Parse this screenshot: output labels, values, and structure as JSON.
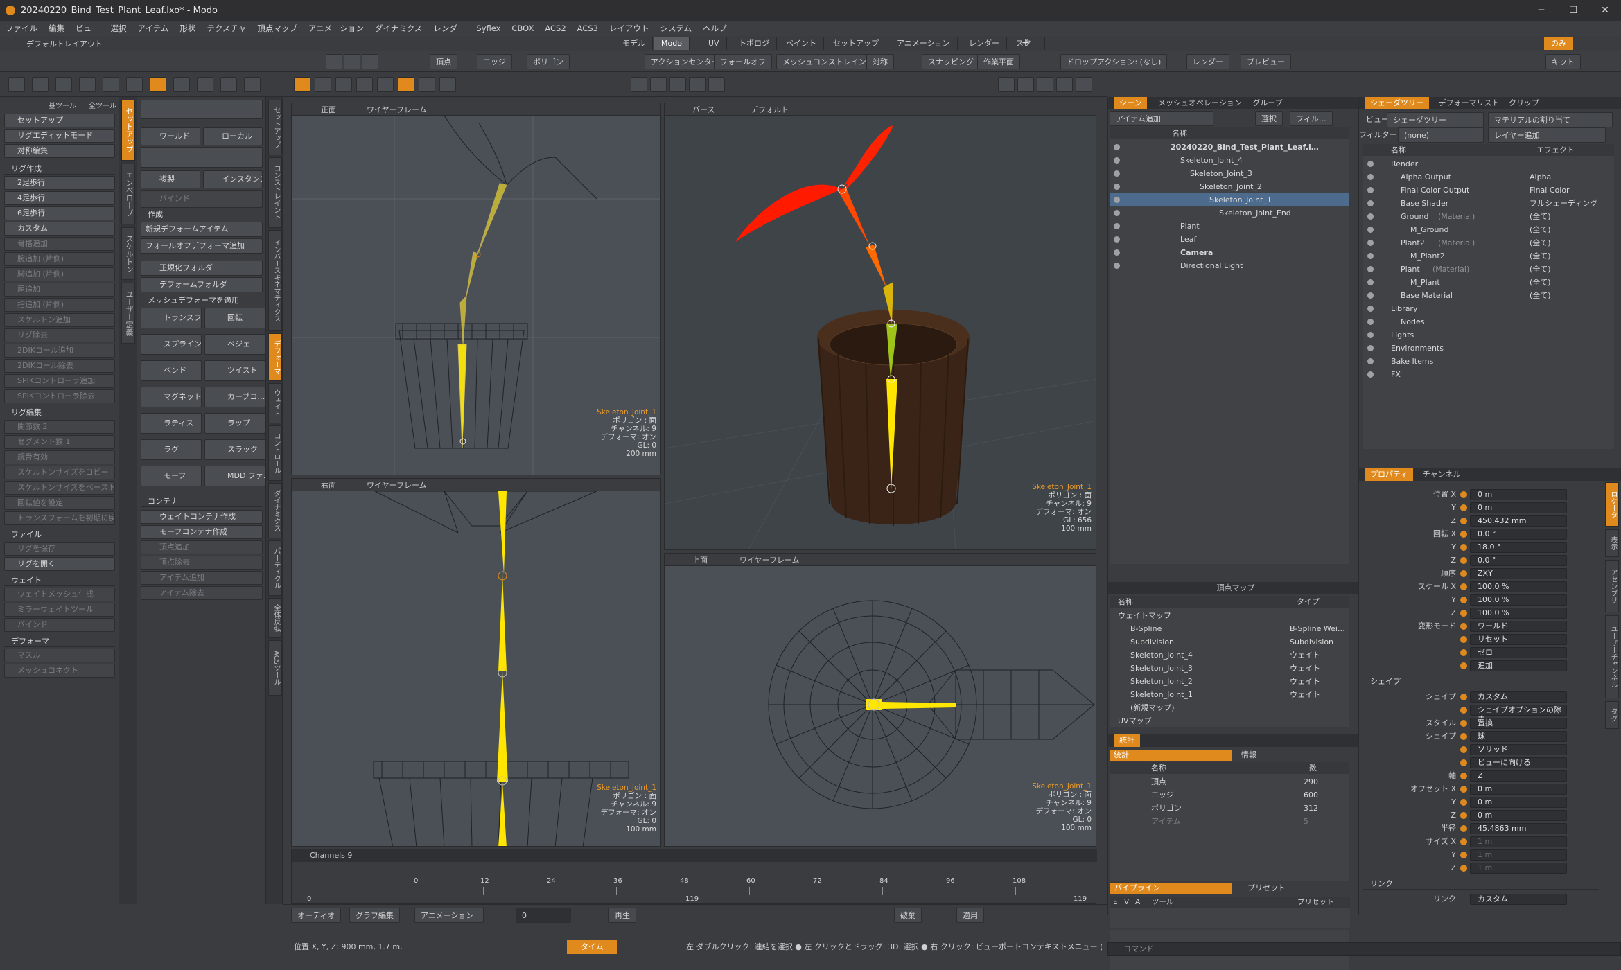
{
  "window": {
    "title": "20240220_Bind_Test_Plant_Leaf.lxo* - Modo",
    "min": "─",
    "max": "☐",
    "close": "✕"
  },
  "menu": [
    "ファイル",
    "編集",
    "ビュー",
    "選択",
    "アイテム",
    "形状",
    "テクスチャ",
    "頂点マップ",
    "アニメーション",
    "ダイナミクス",
    "レンダー",
    "Syflex",
    "CBOX",
    "ACS2",
    "ACS3",
    "レイアウト",
    "システム",
    "ヘルプ"
  ],
  "layout": {
    "name": "デフォルトレイアウト",
    "tabs": [
      "モデル",
      "Modo",
      "UV",
      "トポロジ",
      "ペイント",
      "セットアップ",
      "アニメーション",
      "レンダー",
      "スクリプト"
    ],
    "active": "Modo",
    "plus": "+",
    "user": "のみ"
  },
  "toolbar": {
    "items": [
      "頂点",
      "エッジ",
      "ポリゴン",
      "アクションセンター",
      "フォールオフ",
      "メッシュコンストレイント",
      "対称",
      "スナッピング",
      "作業平面",
      "ドロップアクション: (なし)",
      "レンダー",
      "プレビュー",
      "キット"
    ]
  },
  "left_panel": {
    "top_tabs": [
      "基ツール",
      "全ツール"
    ],
    "buttons": [
      {
        "label": "セットアップ",
        "dim": false
      },
      {
        "label": "リグエディットモード",
        "dim": false
      },
      {
        "label": "対称編集",
        "dim": false
      }
    ],
    "sections": [
      {
        "title": "リグ作成",
        "items": [
          {
            "label": "2足歩行",
            "dim": false
          },
          {
            "label": "4足歩行",
            "dim": false
          },
          {
            "label": "6足歩行",
            "dim": false
          },
          {
            "label": "カスタム",
            "dim": false
          },
          {
            "label": "骨格追加",
            "dim": true
          },
          {
            "label": "腕追加 (片側)",
            "dim": true
          },
          {
            "label": "脚追加 (片側)",
            "dim": true
          },
          {
            "label": "尾追加",
            "dim": true
          },
          {
            "label": "指追加 (片側)",
            "dim": true
          },
          {
            "label": "スケルトン追加",
            "dim": true
          },
          {
            "label": "リグ除去",
            "dim": true
          },
          {
            "label": "2DIKコール追加",
            "dim": true
          },
          {
            "label": "2DIKコール除去",
            "dim": true
          },
          {
            "label": "SPIKコントローラ追加",
            "dim": true
          },
          {
            "label": "SPIKコントローラ除去",
            "dim": true
          }
        ]
      },
      {
        "title": "リグ編集",
        "items": [
          {
            "label": "関節数  2",
            "dim": true
          },
          {
            "label": "セグメント数  1",
            "dim": true
          },
          {
            "label": "鏡骨有効",
            "dim": true
          },
          {
            "label": "スケルトンサイズをコピー",
            "dim": true
          },
          {
            "label": "スケルトンサイズをペースト",
            "dim": true
          },
          {
            "label": "回転値を設定",
            "dim": true
          },
          {
            "label": "トランスフォームを初期に戻す",
            "dim": true
          }
        ]
      },
      {
        "title": "ファイル",
        "items": [
          {
            "label": "リグを保存",
            "dim": true
          },
          {
            "label": "リグを開く",
            "dim": false
          }
        ]
      },
      {
        "title": "ウェイト",
        "items": [
          {
            "label": "ウェイトメッシュ生成",
            "dim": true
          },
          {
            "label": "ミラーウェイトツール",
            "dim": true
          },
          {
            "label": "バインド",
            "dim": true
          }
        ]
      },
      {
        "title": "デフォーマ",
        "items": [
          {
            "label": "マスル",
            "dim": true
          },
          {
            "label": "メッシュコネクト",
            "dim": true
          }
        ]
      }
    ]
  },
  "side_tabs_1": [
    "セットアップ",
    "エンベロープ",
    "スケルトン",
    "ユーザー定義"
  ],
  "mid_panel": {
    "row1": [
      "ワールド",
      "ローカル"
    ],
    "row2": [
      "複製",
      "インスタンス"
    ],
    "bind": "バインド",
    "create_title": "作成",
    "new_deform": "新規デフォームアイテム",
    "falloff_deform": "フォールオフデフォーマ追加",
    "norm_folder": "正規化フォルダ",
    "deform_folder": "デフォームフォルダ",
    "mesh_deform": "メッシュデフォーマを適用",
    "tools": [
      [
        "トランスフ…",
        "回転"
      ],
      [
        "スプライン",
        "ベジェ"
      ],
      [
        "ベンド",
        "ツイスト"
      ],
      [
        "マグネット",
        "カーブコ…"
      ],
      [
        "ラティス",
        "ラップ"
      ],
      [
        "ラグ",
        "スラック"
      ],
      [
        "モーフ",
        "MDD ファ…"
      ]
    ],
    "container_title": "コンテナ",
    "containers": [
      {
        "label": "ウェイトコンテナ作成",
        "dim": false
      },
      {
        "label": "モーフコンテナ作成",
        "dim": false
      },
      {
        "label": "頂点追加",
        "dim": true
      },
      {
        "label": "頂点除去",
        "dim": true
      },
      {
        "label": "アイテム追加",
        "dim": true
      },
      {
        "label": "アイテム除去",
        "dim": true
      }
    ]
  },
  "side_tabs_2": [
    "セットアップ",
    "コンストレイント",
    "インバースキネマティクス",
    "デフォーマ",
    "ウェイト",
    "コントロール",
    "ダイナミクス",
    "パーティクル",
    "全体反転",
    "ACSツール"
  ],
  "viewports": [
    {
      "name": "正面",
      "mode": "ワイヤーフレーム",
      "info": {
        "item": "Skeleton_Joint_1",
        "poly": "ポリゴン : 面",
        "ch": "チャンネル: 9",
        "def": "デフォーマ: オン",
        "gl": "GL: 0",
        "scale": "200 mm"
      }
    },
    {
      "name": "パース",
      "mode": "デフォルト",
      "info": {
        "item": "Skeleton_Joint_1",
        "poly": "ポリゴン : 面",
        "ch": "チャンネル: 9",
        "def": "デフォーマ: オン",
        "gl": "GL: 656",
        "scale": "100 mm"
      }
    },
    {
      "name": "右面",
      "mode": "ワイヤーフレーム",
      "info": {
        "item": "Skeleton_Joint_1",
        "poly": "ポリゴン : 面",
        "ch": "チャンネル: 9",
        "def": "デフォーマ: オン",
        "gl": "GL: 0",
        "scale": "100 mm"
      }
    },
    {
      "name": "上面",
      "mode": "ワイヤーフレーム",
      "info": {
        "item": "Skeleton_Joint_1",
        "poly": "ポリゴン : 面",
        "ch": "チャンネル: 9",
        "def": "デフォーマ: オン",
        "gl": "GL: 0",
        "scale": "100 mm"
      }
    }
  ],
  "scene": {
    "tabs": [
      "シーン",
      "メッシュオペレーション",
      "グループ"
    ],
    "add_item": "アイテム追加",
    "select": "選択",
    "filter": "フィル…",
    "col_name": "名称",
    "rows": [
      {
        "label": "20240220_Bind_Test_Plant_Leaf.l…",
        "indent": 0,
        "sel": false,
        "bold": true
      },
      {
        "label": "Skeleton_Joint_4",
        "indent": 1,
        "sel": false,
        "bold": false
      },
      {
        "label": "Skeleton_Joint_3",
        "indent": 2,
        "sel": false,
        "bold": false
      },
      {
        "label": "Skeleton_Joint_2",
        "indent": 3,
        "sel": false,
        "bold": false
      },
      {
        "label": "Skeleton_Joint_1",
        "indent": 4,
        "sel": true,
        "bold": false
      },
      {
        "label": "Skeleton_Joint_End",
        "indent": 5,
        "sel": false,
        "bold": false
      },
      {
        "label": "Plant",
        "indent": 1,
        "sel": false,
        "bold": false
      },
      {
        "label": "Leaf",
        "indent": 1,
        "sel": false,
        "bold": false
      },
      {
        "label": "Camera",
        "indent": 1,
        "sel": false,
        "bold": true
      },
      {
        "label": "Directional Light",
        "indent": 1,
        "sel": false,
        "bold": false
      }
    ]
  },
  "vertex_map": {
    "title": "頂点マップ",
    "col_name": "名称",
    "col_type": "タイプ",
    "rows": [
      {
        "name": "ウェイトマップ",
        "type": "",
        "indent": 0
      },
      {
        "name": "B-Spline",
        "type": "B-Spline Wei…",
        "indent": 1
      },
      {
        "name": "Subdivision",
        "type": "Subdivision",
        "indent": 1
      },
      {
        "name": "Skeleton_Joint_4",
        "type": "ウェイト",
        "indent": 1
      },
      {
        "name": "Skeleton_Joint_3",
        "type": "ウェイト",
        "indent": 1
      },
      {
        "name": "Skeleton_Joint_2",
        "type": "ウェイト",
        "indent": 1
      },
      {
        "name": "Skeleton_Joint_1",
        "type": "ウェイト",
        "indent": 1
      },
      {
        "name": "(新規マップ)",
        "type": "",
        "indent": 1
      },
      {
        "name": "UVマップ",
        "type": "",
        "indent": 0
      }
    ]
  },
  "stats": {
    "tabs": [
      "統計",
      "情報"
    ],
    "col_name": "名称",
    "col_count": "数",
    "rows": [
      {
        "name": "頂点",
        "count": "290"
      },
      {
        "name": "エッジ",
        "count": "600"
      },
      {
        "name": "ポリゴン",
        "count": "312"
      },
      {
        "name": "アイテム",
        "count": "5"
      }
    ]
  },
  "pipeline": {
    "tabs": [
      "パイプライン",
      "プリセット"
    ],
    "cols": [
      "E",
      "V",
      "A",
      "ツール",
      "プリセット"
    ]
  },
  "shader": {
    "tabs": [
      "シェーダツリー",
      "デフォーマリスト",
      "クリップ"
    ],
    "view_label": "ビュー",
    "view_value": "シェーダツリー",
    "assign": "マテリアルの割り当て",
    "filter_label": "フィルター",
    "filter_value": "(none)",
    "add_layer": "レイヤー追加",
    "col_name": "名称",
    "col_effect": "エフェクト",
    "rows": [
      {
        "name": "Render",
        "effect": "",
        "indent": 0
      },
      {
        "name": "Alpha Output",
        "effect": "Alpha",
        "indent": 1
      },
      {
        "name": "Final Color Output",
        "effect": "Final Color",
        "indent": 1
      },
      {
        "name": "Base Shader",
        "effect": "フルシェーディング",
        "indent": 1
      },
      {
        "name": "Ground",
        "sub": "(Material)",
        "effect": "(全て)",
        "indent": 1
      },
      {
        "name": "M_Ground",
        "effect": "(全て)",
        "indent": 2
      },
      {
        "name": "Plant2",
        "sub": "(Material)",
        "effect": "(全て)",
        "indent": 1
      },
      {
        "name": "M_Plant2",
        "effect": "(全て)",
        "indent": 2
      },
      {
        "name": "Plant",
        "sub": "(Material)",
        "effect": "(全て)",
        "indent": 1
      },
      {
        "name": "M_Plant",
        "effect": "(全て)",
        "indent": 2
      },
      {
        "name": "Base Material",
        "effect": "(全て)",
        "indent": 1
      },
      {
        "name": "Library",
        "effect": "",
        "indent": 0
      },
      {
        "name": "Nodes",
        "effect": "",
        "indent": 1
      },
      {
        "name": "Lights",
        "effect": "",
        "indent": 0
      },
      {
        "name": "Environments",
        "effect": "",
        "indent": 0
      },
      {
        "name": "Bake Items",
        "effect": "",
        "indent": 0
      },
      {
        "name": "FX",
        "effect": "",
        "indent": 0
      }
    ]
  },
  "properties": {
    "tabs": [
      "プロパティ",
      "チャンネル"
    ],
    "side_tabs": [
      "ロケータ",
      "表示",
      "アセンブリ",
      "ユーザーチャンネル",
      "タグ"
    ],
    "rows": [
      {
        "label": "位置 X",
        "value": "0 m"
      },
      {
        "label": "Y",
        "value": "0 m"
      },
      {
        "label": "Z",
        "value": "450.432 mm"
      },
      {
        "label": "回転 X",
        "value": "0.0 °"
      },
      {
        "label": "Y",
        "value": "18.0 °"
      },
      {
        "label": "Z",
        "value": "0.0 °"
      },
      {
        "label": "順序",
        "value": "ZXY"
      },
      {
        "label": "スケール X",
        "value": "100.0 %"
      },
      {
        "label": "Y",
        "value": "100.0 %"
      },
      {
        "label": "Z",
        "value": "100.0 %"
      },
      {
        "label": "変形モード",
        "value": "ワールド"
      },
      {
        "label": "",
        "value": "リセット"
      },
      {
        "label": "",
        "value": "ゼロ"
      },
      {
        "label": "",
        "value": "追加"
      }
    ],
    "shape_title": "シェイプ",
    "shape_rows": [
      {
        "label": "シェイプ",
        "value": "カスタム"
      },
      {
        "label": "",
        "value": "シェイプオプションの除去"
      },
      {
        "label": "スタイル",
        "value": "置換"
      },
      {
        "label": "シェイプ",
        "value": "球"
      },
      {
        "label": "",
        "value": "ソリッド"
      },
      {
        "label": "",
        "value": "ビューに向ける"
      },
      {
        "label": "軸",
        "value": "Z"
      },
      {
        "label": "オフセット X",
        "value": "0 m"
      },
      {
        "label": "Y",
        "value": "0 m"
      },
      {
        "label": "Z",
        "value": "0 m"
      },
      {
        "label": "半径",
        "value": "45.4863 mm"
      },
      {
        "label": "サイズ X",
        "value": "1 m"
      },
      {
        "label": "Y",
        "value": "1 m"
      },
      {
        "label": "Z",
        "value": "1 m"
      }
    ],
    "link_title": "リンク",
    "link_rows": [
      {
        "label": "リンク",
        "value": "カスタム"
      }
    ]
  },
  "timeline": {
    "channels": "Channels 9",
    "ticks": [
      "0",
      "12",
      "24",
      "36",
      "48",
      "60",
      "72",
      "84",
      "96",
      "108"
    ],
    "start": "0",
    "end": "119",
    "end2": "119"
  },
  "transport": {
    "audio": "オーディオ",
    "graph": "グラフ編集",
    "anim": "アニメーション",
    "frame": "0",
    "play": "再生",
    "key": "破棄",
    "apply": "適用"
  },
  "status": {
    "pos": "位置 X, Y, Z:  900 mm, 1.7 m,",
    "time": "タイム",
    "hint": "左 ダブルクリック: 連結を選択 ● 左 クリックとドラッグ: 3D: 選択 ● 右 クリック: ビューポートコンテキストメニュー (アクティ…",
    "cmd": "コマンド"
  },
  "colors": {
    "accent": "#e08a1e",
    "selected": "#4d6b8c",
    "leaf_red": "#ff1a00",
    "bone_yellow": "#ffe600"
  }
}
